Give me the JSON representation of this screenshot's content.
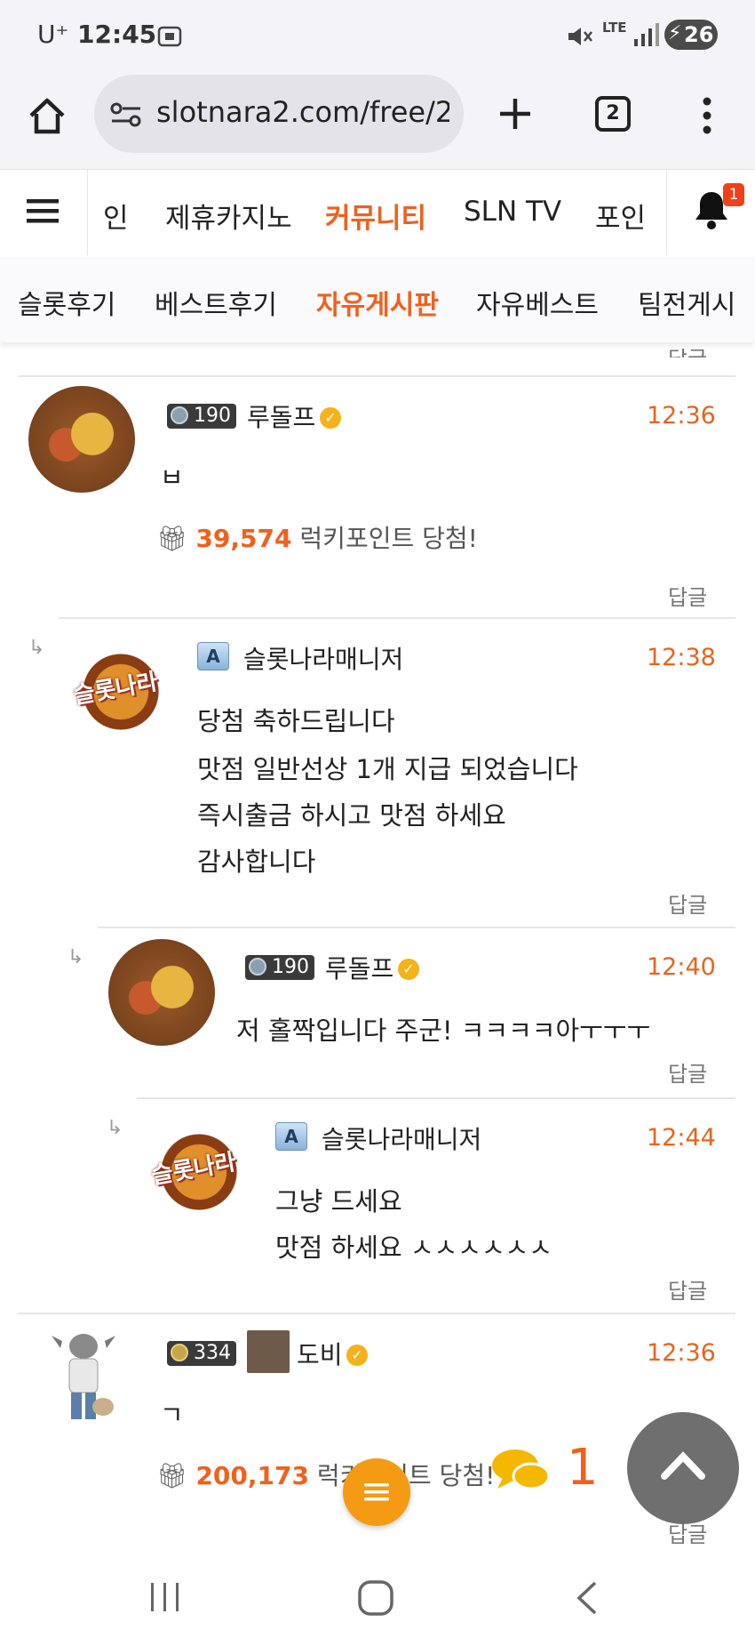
{
  "status": {
    "carrier": "U⁺",
    "time": "12:45",
    "network": "LTE",
    "battery": "26"
  },
  "browser": {
    "url": "slotnara2.com/free/2",
    "tab_count": "2"
  },
  "topnav": {
    "items": [
      "인",
      "제휴카지노",
      "커뮤니티",
      "SLN TV",
      "포인"
    ],
    "active": "커뮤니티",
    "notification_count": "1"
  },
  "subnav": {
    "items": [
      "슬롯후기",
      "베스트후기",
      "자유게시판",
      "자유베스트",
      "팀전게시"
    ],
    "active": "자유게시판"
  },
  "reply_label": "답글",
  "comments": [
    {
      "level": "190",
      "name": "루돌프",
      "time": "12:36",
      "text": "ㅂ",
      "lucky_amount": "39,574",
      "lucky_text": "럭키포인트 당첨!"
    },
    {
      "name": "슬롯나라매니저",
      "time": "12:38",
      "lines": [
        "당첨 축하드립니다",
        "맛점 일반선상 1개 지급 되었습니다",
        "즉시출금 하시고 맛점 하세요",
        "감사합니다"
      ]
    },
    {
      "level": "190",
      "name": "루돌프",
      "time": "12:40",
      "text": "저 홀짝입니다 주군! ㅋㅋㅋㅋ아ㅜㅜㅜ"
    },
    {
      "name": "슬롯나라매니저",
      "time": "12:44",
      "lines": [
        "그냥 드세요",
        "맛점 하세요 ㅅㅅㅅㅅㅅㅅ"
      ]
    },
    {
      "level": "334",
      "name": "도비",
      "time": "12:36",
      "text": "ㄱ",
      "lucky_amount": "200,173",
      "lucky_text": "럭키포인트 당첨!"
    }
  ],
  "chat_count": "1",
  "colors": {
    "accent": "#f0611b",
    "fab_menu": "#f59a13",
    "fab_up": "#6f6f6f"
  }
}
